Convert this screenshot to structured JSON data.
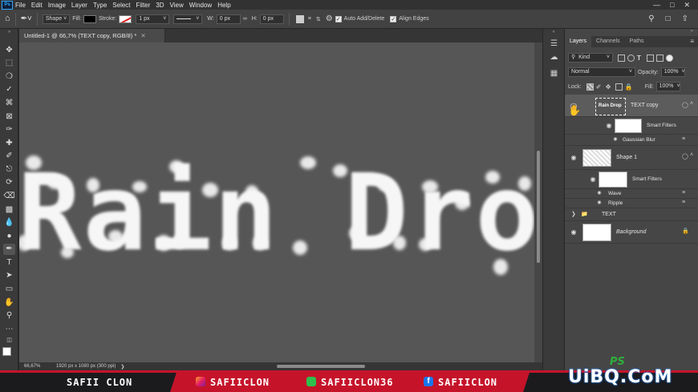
{
  "menu": [
    "File",
    "Edit",
    "Image",
    "Layer",
    "Type",
    "Select",
    "Filter",
    "3D",
    "View",
    "Window",
    "Help"
  ],
  "options": {
    "mode": "Shape",
    "fill_label": "Fill:",
    "stroke_label": "Stroke:",
    "stroke_width": "1 px",
    "w_label": "W:",
    "w_value": "0 px",
    "h_label": "H:",
    "h_value": "0 px",
    "auto_add_delete": "Auto Add/Delete",
    "align_edges": "Align Edges"
  },
  "document": {
    "tab_title": "Untitled-1 @ 66,7% (TEXT copy, RGB/8) *",
    "canvas_text": "Rain Drop",
    "zoom": "66,67%",
    "doc_info": "1920 px x 1080 px (300 ppi)"
  },
  "panel": {
    "tabs": [
      "Layers",
      "Channels",
      "Paths"
    ],
    "kind": "Kind",
    "blend_mode": "Normal",
    "opacity_label": "Opacity:",
    "opacity": "100%",
    "lock_label": "Lock:",
    "fill_label": "Fill:",
    "fill": "100%"
  },
  "layers": {
    "text_copy": {
      "name": "TEXT copy",
      "thumb_text": "Rain Drop",
      "smart_filters": "Smart Filters",
      "filter": "Gaussian Blur"
    },
    "shape": {
      "name": "Shape 1",
      "smart_filters": "Smart Filters",
      "filters": [
        "Wave",
        "Ripple"
      ]
    },
    "text_group": {
      "name": "TEXT"
    },
    "background": {
      "name": "Background"
    }
  },
  "banner": {
    "name": "SAFII CLON",
    "instagram": "SAFIICLON",
    "second": "SAFIICLON36",
    "facebook": "SAFIICLON"
  },
  "watermark": {
    "ps": "PS",
    "site": "UiBQ.CoM"
  },
  "colors": {
    "accent": "#31a8ff",
    "banner_red": "#c5142a",
    "canvas": "#565656"
  }
}
